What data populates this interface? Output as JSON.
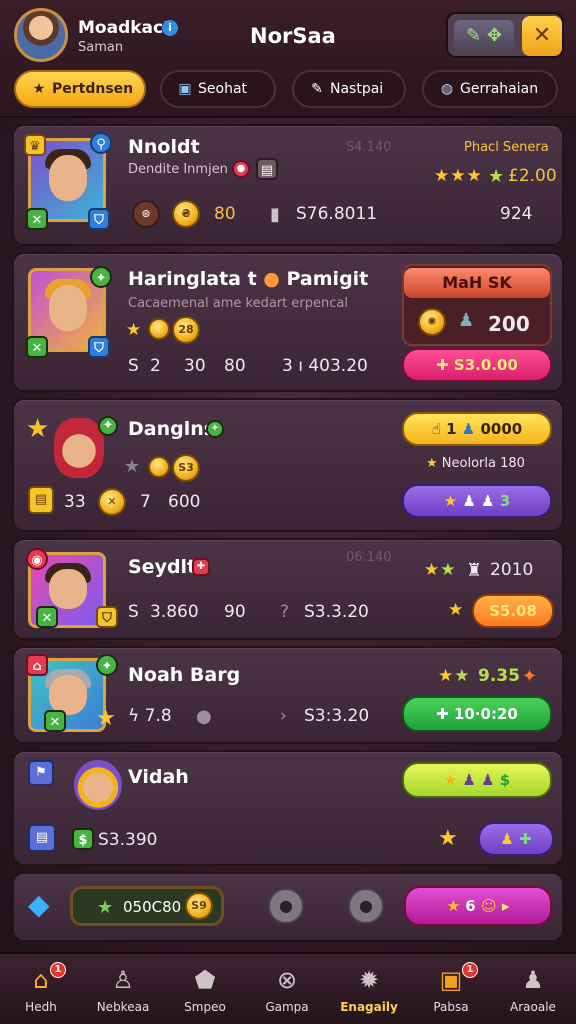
{
  "header": {
    "user_name": "Moadkact",
    "user_subtitle": "Saman",
    "title": "NorSaa",
    "tools_icon": "hammer-wrench-icon",
    "close_icon": "close-icon"
  },
  "tabs": [
    {
      "label": "Pertdnsen",
      "icon": "star-icon"
    },
    {
      "label": "Seohat",
      "icon": "card-icon"
    },
    {
      "label": "Nastpai",
      "icon": "pen-icon"
    },
    {
      "label": "Gerrahaian",
      "icon": "planet-icon"
    }
  ],
  "cards": [
    {
      "name": "Nnoldt",
      "subtitle": "Dendite Inmjen",
      "faint": "S4.140",
      "tag": "Phacl Senera",
      "rating": "★★★",
      "rating_value": "£2.00",
      "coin_value": "80",
      "amount": "S76.8011",
      "right": "924"
    },
    {
      "name": "Haringlata t",
      "name_extra": "Pamigit",
      "subtitle": "Cacaemenal ame kedart erpencal",
      "coin_value": "28",
      "price_label": "S",
      "stat_a": "2",
      "stat_b": "30",
      "stat_c": "80",
      "amount": "3 ı 403.20",
      "panel_title": "MaH SK",
      "panel_value": "200",
      "pill": "S3.0.00"
    },
    {
      "name": "Danglns",
      "coin_value": "S3",
      "left_num": "33",
      "stat": "7",
      "stat_b": "600",
      "pill_left": "1",
      "pill_value": "0000",
      "mid_text": "Neolorla 180",
      "purple_value": "3"
    },
    {
      "name": "Seydlt",
      "faint": "06.140",
      "price_label": "S",
      "stat_a": "3.860",
      "stat_b": "90",
      "amount": "S3.3.20",
      "rating_value": "2010",
      "pill": "S5.08"
    },
    {
      "name": "Noah Barg",
      "stat_a": "7.8",
      "amount": "S3:3.20",
      "rating_value": "9.35",
      "pill": "10·0:20"
    },
    {
      "name": "Vidah",
      "amount": "S3.390"
    }
  ],
  "bottom_bar": {
    "counter": "050C80",
    "coin": "S9",
    "pill_value": "6"
  },
  "nav": [
    {
      "label": "Hedh",
      "icon": "home-icon",
      "badge": "1"
    },
    {
      "label": "Nebkeaa",
      "icon": "person-icon",
      "badge": ""
    },
    {
      "label": "Smpeo",
      "icon": "badge-icon",
      "badge": ""
    },
    {
      "label": "Gampa",
      "icon": "compass-icon",
      "badge": ""
    },
    {
      "label": "Enagaily",
      "icon": "gear-icon",
      "badge": ""
    },
    {
      "label": "Pabsa",
      "icon": "chest-icon",
      "badge": "1"
    },
    {
      "label": "Araoale",
      "icon": "profile-icon",
      "badge": ""
    }
  ]
}
